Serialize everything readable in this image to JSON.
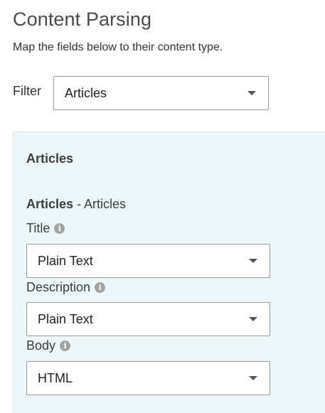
{
  "header": {
    "title": "Content Parsing",
    "subtitle": "Map the fields below to their content type."
  },
  "filter": {
    "label": "Filter",
    "selected": "Articles"
  },
  "panel": {
    "heading": "Articles",
    "section_bold": "Articles",
    "section_rest": " - Articles",
    "fields": [
      {
        "label": "Title",
        "value": "Plain Text"
      },
      {
        "label": "Description",
        "value": "Plain Text"
      },
      {
        "label": "Body",
        "value": "HTML"
      }
    ]
  },
  "icons": {
    "info": "info-icon",
    "dropdown": "chevron-down-icon"
  },
  "colors": {
    "panel_background": "#edf6f9",
    "panel_border": "#d6e6ec",
    "select_border": "#9a9a9a",
    "info_icon": "#a3a3a3"
  }
}
